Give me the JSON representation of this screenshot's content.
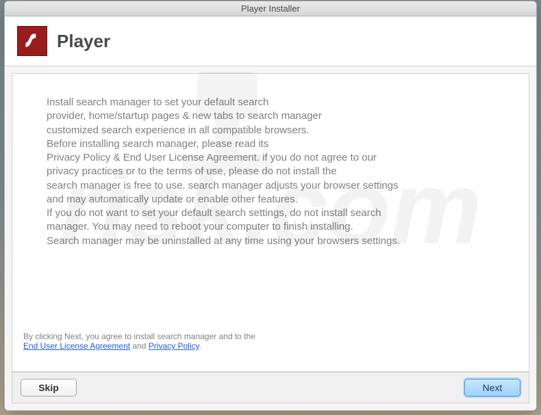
{
  "titlebar": {
    "title": "Player Installer"
  },
  "header": {
    "title": "Player"
  },
  "body": {
    "text": "Install search manager to set your default search\nprovider, home/startup pages & new tabs to search manager\ncustomized search experience in all compatible browsers.\nBefore installing search manager, please read its\nPrivacy Policy & End User License Agreement. if you do not agree to our\nprivacy practices or to the terms of use, please do not install the\nsearch manager is free to use. search manager adjusts your browser settings\nand may automatically update or enable other features.\nIf you do not want to set your default search settings, do not install search\nmanager. You may need to reboot your computer to finish installing.\nSearch manager may be uninstalled at any time using your browsers settings."
  },
  "footer": {
    "prefix": "By clicking Next, you agree to install search manager and to the",
    "eula_link": "End User License Agreement",
    "and": " and ",
    "privacy_link": "Privacy Policy",
    "period": "."
  },
  "buttons": {
    "skip": "Skip",
    "next": "Next"
  },
  "watermark": {
    "text": "risk.com"
  }
}
